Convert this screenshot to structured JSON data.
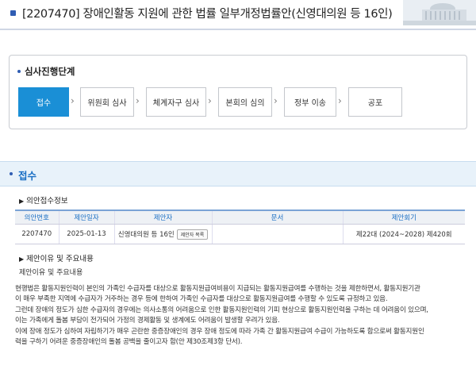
{
  "header": {
    "title": "[2207470] 장애인활동 지원에 관한 법률 일부개정법률안(신영대의원 등 16인)"
  },
  "stages": {
    "heading": "심사진행단계",
    "items": [
      {
        "label": "접수",
        "active": true
      },
      {
        "label": "위원회 심사",
        "active": false
      },
      {
        "label": "체계자구 심사",
        "active": false
      },
      {
        "label": "본회의 심의",
        "active": false
      },
      {
        "label": "정부 이송",
        "active": false
      },
      {
        "label": "공포",
        "active": false
      }
    ]
  },
  "section": {
    "title": "접수"
  },
  "receipt": {
    "heading": "의안접수정보",
    "columns": [
      "의안번호",
      "제안일자",
      "제안자",
      "문서",
      "제안회기"
    ],
    "row": {
      "bill_no": "2207470",
      "date": "2025-01-13",
      "proposer": "신영대의원 등 16인",
      "proposer_button": "제안자 목록",
      "document": "",
      "session": "제22대 (2024~2028) 제420회"
    }
  },
  "reason": {
    "heading": "제안이유 및 주요내용",
    "subheading": "제안이유 및 주요내용",
    "lines": [
      "현행법은 활동지원인력이 본인의 가족인 수급자를 대상으로 활동지원급여비용이 지급되는 활동지원급여를 수행하는 것을 제한하면서, 활동지원기관",
      "이 매우 부족한 지역에 수급자가 거주하는 경우 등에 한하여 가족인 수급자를 대상으로 활동지원급여를 수행할 수 있도록 규정하고 있음.",
      "그런데 장애의 정도가 심한 수급자의 경우에는 의사소통의 어려움으로 인한 활동지원인력의 기피 현상으로 활동지원인력을 구하는 데 어려움이 있으며,",
      "이는 가족에게 돌봄 부담이 전가되어 가정의 경제활동 및 생계에도 어려움이 발생할 우려가 있음.",
      "이에 장애 정도가 심하여 자립하기가 매우 곤란한 중증장애인의 경우 장애 정도에 따라 가족 간 활동지원급여 수급이 가능하도록 함으로써 활동지원인",
      "력을 구하기 어려운 중증장애인의 돌봄 공백을 줄이고자 함(안 제30조제3항 단서)."
    ]
  },
  "colors": {
    "accent": "#1a8fd6",
    "label_blue": "#1a6fc4",
    "section_bg": "#e8f2fa"
  }
}
